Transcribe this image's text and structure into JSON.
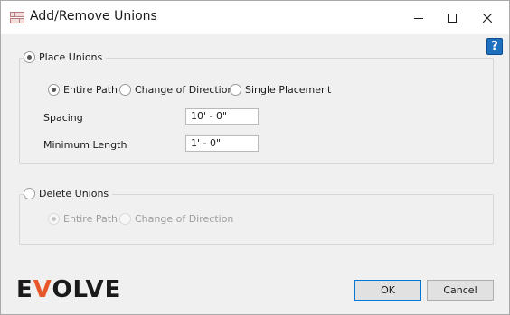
{
  "window": {
    "title": "Add/Remove Unions",
    "controls": {
      "minimize_icon": "minimize-icon",
      "maximize_icon": "maximize-icon",
      "close_icon": "close-icon"
    }
  },
  "help": {
    "label": "?"
  },
  "place_unions": {
    "label": "Place Unions",
    "checked": true,
    "options": [
      {
        "label": "Entire Path",
        "checked": true
      },
      {
        "label": "Change of Direction",
        "checked": false
      },
      {
        "label": "Single Placement",
        "checked": false
      }
    ],
    "spacing": {
      "label": "Spacing",
      "value": "10' - 0\""
    },
    "minimum_length": {
      "label": "Minimum Length",
      "value": "1' - 0\""
    }
  },
  "delete_unions": {
    "label": "Delete Unions",
    "checked": false,
    "options": [
      {
        "label": "Entire Path",
        "checked": true,
        "disabled": true
      },
      {
        "label": "Change of Direction",
        "checked": false,
        "disabled": true
      }
    ]
  },
  "logo": {
    "part1": "E",
    "part2": "V",
    "part3": "OLVE",
    "accent_color": "#e8572a"
  },
  "buttons": {
    "ok": "OK",
    "cancel": "Cancel"
  }
}
